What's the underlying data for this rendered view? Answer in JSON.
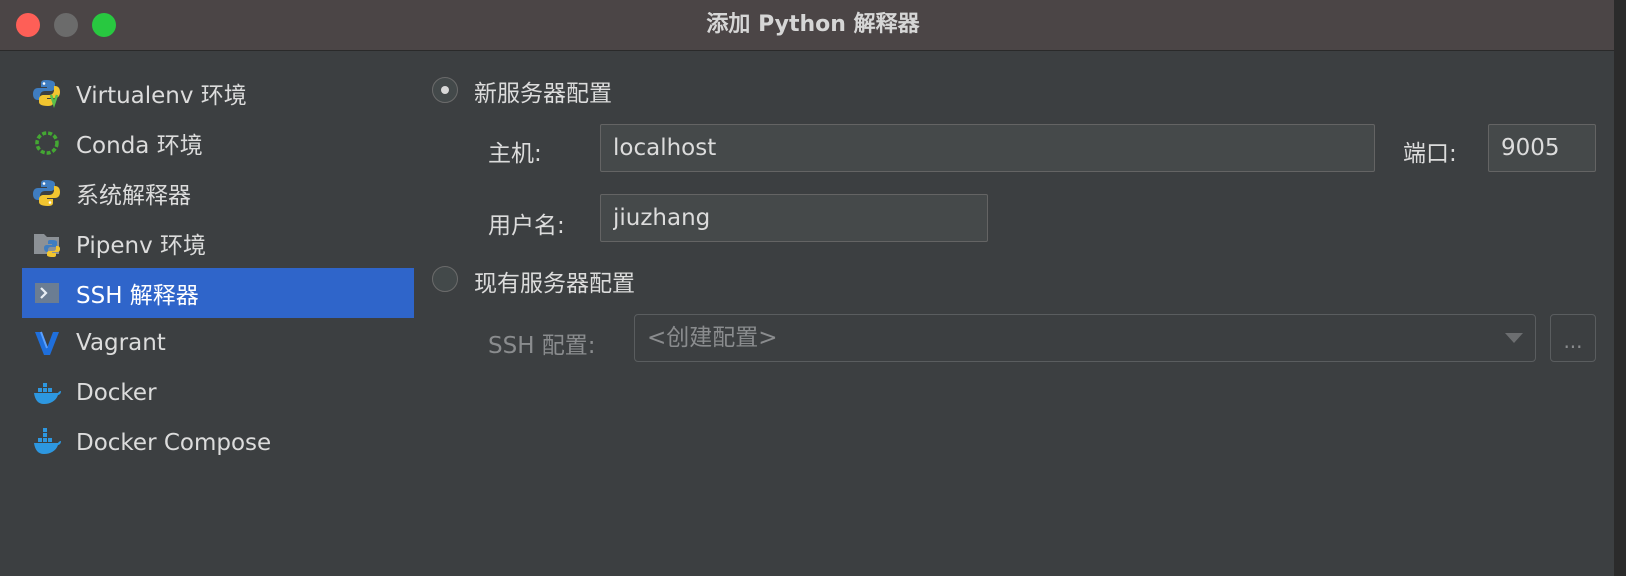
{
  "window": {
    "title": "添加 Python 解释器"
  },
  "sidebar": {
    "items": [
      {
        "label": "Virtualenv 环境",
        "icon": "virtualenv-python-icon"
      },
      {
        "label": "Conda 环境",
        "icon": "conda-icon"
      },
      {
        "label": "系统解释器",
        "icon": "python-icon"
      },
      {
        "label": "Pipenv 环境",
        "icon": "pipenv-folder-python-icon"
      },
      {
        "label": "SSH 解释器",
        "icon": "ssh-terminal-icon",
        "selected": true
      },
      {
        "label": "Vagrant",
        "icon": "vagrant-icon"
      },
      {
        "label": "Docker",
        "icon": "docker-icon"
      },
      {
        "label": "Docker Compose",
        "icon": "docker-compose-icon"
      }
    ]
  },
  "form": {
    "new_server": {
      "label": "新服务器配置",
      "selected": true,
      "host_label": "主机:",
      "host_value": "localhost",
      "port_label": "端口:",
      "port_value": "9005",
      "username_label": "用户名:",
      "username_value": "jiuzhang"
    },
    "existing_server": {
      "label": "现有服务器配置",
      "selected": false,
      "ssh_config_label": "SSH 配置:",
      "ssh_config_value": "<创建配置>",
      "browse_label": "..."
    }
  },
  "colors": {
    "selection": "#2f65ca",
    "background": "#3c3f41",
    "titlebar": "#4b4546"
  }
}
